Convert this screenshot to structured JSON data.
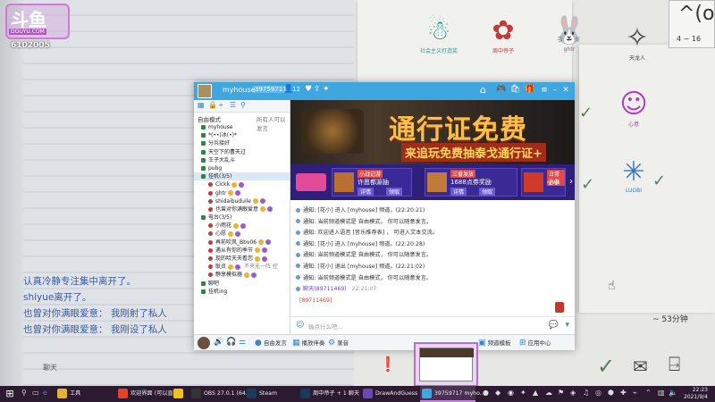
{
  "stream": {
    "logo_text": "斗鱼",
    "logo_sub": "DOUYU.COM",
    "room_id": "6102005",
    "note_card_face": "^(oo)^",
    "note_card_range": "4 ~ 16",
    "minutes_label": "~ 53分钟",
    "side_label": "聊天",
    "doodles": [
      {
        "pic": "☃",
        "cap": "社会主义打造奖"
      },
      {
        "pic": "✿",
        "cap": "周中帝子"
      },
      {
        "pic": "🐰",
        "cap": "ghtr"
      },
      {
        "pic": "✧",
        "cap": "天龙人"
      },
      {
        "pic": "☺",
        "cap": "心意"
      },
      {
        "pic": "✳",
        "cap": "LUOBI"
      }
    ],
    "chat_overlay": [
      "认真冷静专注集中离开了。",
      "shiyue离开了。",
      "也曾对你满眼爱意： 我刚射了私人",
      "也曾对你满眼爱意： 我刚设了私人"
    ]
  },
  "app": {
    "title": {
      "name": "myhouse",
      "room_tag": "39759717",
      "count": "12"
    },
    "sidebar": {
      "heading_left": "自由模式",
      "heading_right": "所有人可以发言",
      "items": [
        {
          "label": "myhouse",
          "level": "top"
        },
        {
          "label": "*(••)冰(•)*",
          "level": "top"
        },
        {
          "label": "分兵接好",
          "level": "top"
        },
        {
          "label": "天空下的曹天过",
          "level": "top"
        },
        {
          "label": "王子大乱斗",
          "level": "top"
        },
        {
          "label": "pubg",
          "level": "top"
        },
        {
          "label": "挂机(3/5)",
          "level": "top",
          "selected": true
        },
        {
          "label": "Clckk",
          "level": "sub"
        },
        {
          "label": "ghtr",
          "level": "sub"
        },
        {
          "label": "shidaibuduile",
          "level": "sub"
        },
        {
          "label": "也曾对你满眼爱意",
          "level": "sub"
        },
        {
          "label": "电台(3/5)",
          "level": "top"
        },
        {
          "label": "小雨花",
          "level": "sub"
        },
        {
          "label": "心愿",
          "level": "sub"
        },
        {
          "label": "再前吹风_Bbv06",
          "level": "sub"
        },
        {
          "label": "遇从有你的季节",
          "level": "sub"
        },
        {
          "label": "现的哈天天看您",
          "level": "sub"
        },
        {
          "label": "耿贞",
          "level": "sub",
          "extra": "不来无一阵 控"
        },
        {
          "label": "静享模拟器",
          "level": "sub"
        },
        {
          "label": "聊吧",
          "level": "top"
        },
        {
          "label": "挂机ing",
          "level": "top"
        }
      ]
    },
    "banner": {
      "headline": "通行证免费",
      "subline": "来追玩免费抽泰戈通行证+"
    },
    "cards": [
      {
        "tag": "小战记游",
        "title": "许愿都源抽",
        "act": "详情",
        "act2": "领取"
      },
      {
        "tag": "三番发放",
        "title": "1688点券奖励",
        "act": "详情",
        "act2": "领取"
      },
      {
        "tag": "日常必做",
        "title": "小小",
        "act": "详情",
        "act2": "领取"
      }
    ],
    "messages": [
      {
        "kind": "sys",
        "text": "通知:  [花小] 进入 [myhouse] 频道。(22:20:21)"
      },
      {
        "kind": "sys",
        "text": "通知:  当前频道模式是 自由模式， 你可以随意发言。"
      },
      {
        "kind": "sys",
        "text": "通知:  欢迎进入语音 [音乐推荐表] ， 可进入文本交流。"
      },
      {
        "kind": "sys",
        "text": "通知:  [花小] 进入 [myhouse] 频道。(22:20:28)"
      },
      {
        "kind": "sys",
        "text": "通知:  当前频道模式是 自由模式， 你可以随意发言。"
      },
      {
        "kind": "sys",
        "text": "通知:  [花小] 退出 [myhouse] 频道。(22:21:02)"
      },
      {
        "kind": "sys",
        "text": "通知:  当前频道模式是 自由模式， 你可以随意发言。"
      },
      {
        "kind": "user",
        "text": "聊天(89711469)",
        "time": "22:21:07"
      },
      {
        "kind": "red",
        "text": "[89711469]"
      }
    ],
    "input_placeholder": "输点什么吧...",
    "bottom_bar": {
      "b1": "自由发言",
      "b2": "播放伴奏",
      "b3": "录音",
      "b4": "频道模板",
      "b5": "应用中心"
    }
  },
  "taskbar": {
    "items": [
      {
        "label": "工具",
        "color": "#e8b030"
      },
      {
        "label": "欢迎界面 (可以直接...",
        "color": "#e0452c"
      },
      {
        "label": "",
        "color": "#f0c020"
      },
      {
        "label": "OBS 27.0.1 (64...",
        "color": "#333333"
      },
      {
        "label": "Steam",
        "color": "#1b3a5a"
      },
      {
        "label": "周中帝子 + 1 聊天",
        "color": "#1b3a5a"
      },
      {
        "label": "DrawAndGuess",
        "color": "#6a4ab0"
      },
      {
        "label": "39759717 myho...",
        "color": "#3fa6e0"
      }
    ],
    "clock_time": "22:23",
    "clock_date": "2021/9/4"
  }
}
